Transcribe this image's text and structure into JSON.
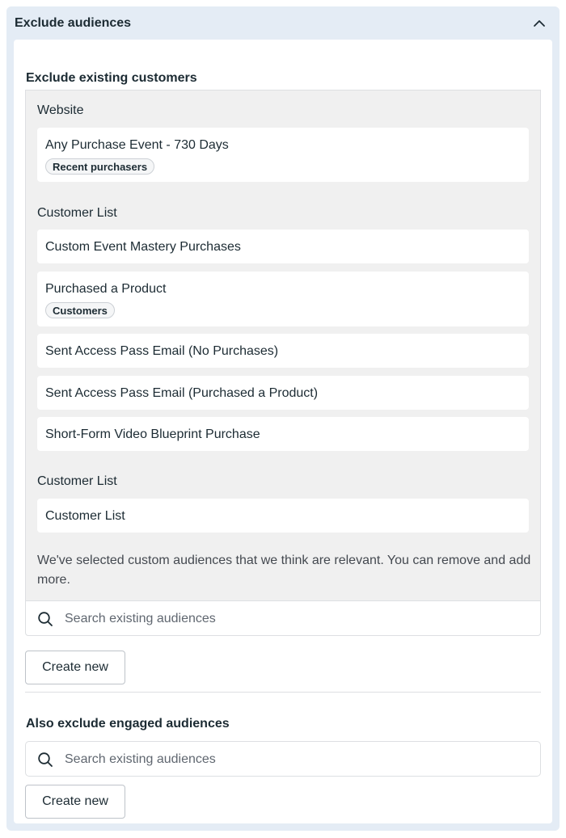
{
  "panel": {
    "title": "Exclude audiences",
    "collapse_icon": "chevron-up-icon"
  },
  "existing": {
    "title": "Exclude existing customers",
    "groups": [
      {
        "label": "Website",
        "items": [
          {
            "name": "Any Purchase Event - 730 Days",
            "tag": "Recent purchasers"
          }
        ]
      },
      {
        "label": "Customer List",
        "items": [
          {
            "name": "Custom Event Mastery Purchases"
          },
          {
            "name": "Purchased a Product",
            "tag": "Customers"
          },
          {
            "name": "Sent Access Pass Email (No Purchases)"
          },
          {
            "name": "Sent Access Pass Email (Purchased a Product)"
          },
          {
            "name": "Short-Form Video Blueprint Purchase"
          }
        ]
      },
      {
        "label": "Customer List",
        "items": [
          {
            "name": "Customer List"
          }
        ]
      }
    ],
    "note": "We've selected custom audiences that we think are relevant. You can remove and add more.",
    "search_placeholder": "Search existing audiences",
    "create_label": "Create new"
  },
  "engaged": {
    "title": "Also exclude engaged audiences",
    "search_placeholder": "Search existing audiences",
    "create_label": "Create new"
  }
}
